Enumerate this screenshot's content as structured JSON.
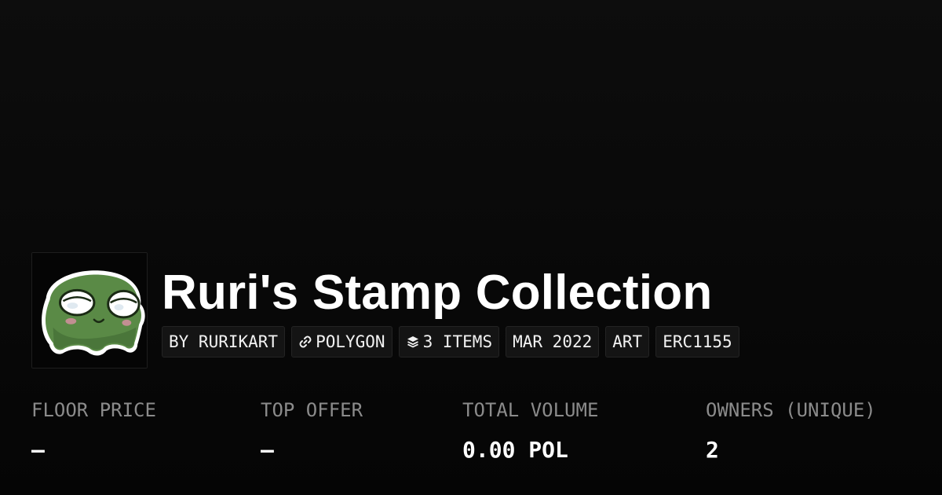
{
  "collection": {
    "title": "Ruri's Stamp Collection",
    "avatar_icon": "green-frog-stamp-icon"
  },
  "tags": [
    {
      "label": "BY RURIKART",
      "icon": null
    },
    {
      "label": "POLYGON",
      "icon": "chain-link-icon"
    },
    {
      "label": "3 ITEMS",
      "icon": "layers-icon"
    },
    {
      "label": "MAR 2022",
      "icon": null
    },
    {
      "label": "ART",
      "icon": null
    },
    {
      "label": "ERC1155",
      "icon": null
    }
  ],
  "stats": [
    {
      "label": "FLOOR PRICE",
      "value": "–"
    },
    {
      "label": "TOP OFFER",
      "value": "–"
    },
    {
      "label": "TOTAL VOLUME",
      "value": "0.00 POL"
    },
    {
      "label": "OWNERS (UNIQUE)",
      "value": "2"
    }
  ],
  "colors": {
    "background": "#0a0a0a",
    "text": "#ffffff",
    "muted": "#8b8b8b",
    "tag_bg": "#141414",
    "avatar_green": "#5a8a46"
  }
}
